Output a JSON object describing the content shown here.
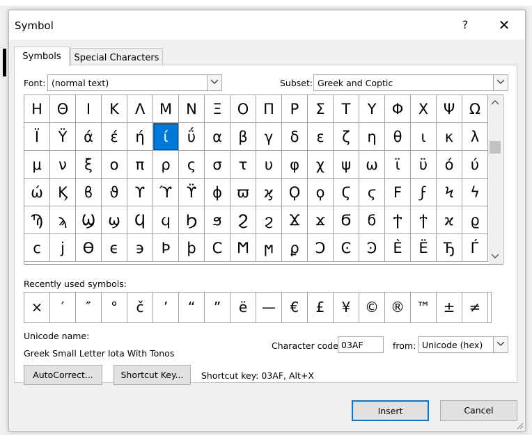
{
  "window": {
    "title": "Symbol",
    "help_label": "?",
    "close_label": "✕"
  },
  "tabs": [
    {
      "label": "Symbols",
      "active": true
    },
    {
      "label": "Special Characters",
      "active": false
    }
  ],
  "font": {
    "label": "Font:",
    "value": "(normal text)"
  },
  "subset": {
    "label": "Subset:",
    "value": "Greek and Coptic"
  },
  "symbol_grid": {
    "rows": [
      [
        "Η",
        "Θ",
        "Ι",
        "Κ",
        "Λ",
        "Μ",
        "Ν",
        "Ξ",
        "Ο",
        "Π",
        "Ρ",
        "Σ",
        "Τ",
        "Υ",
        "Φ",
        "Χ",
        "Ψ",
        "Ω"
      ],
      [
        "Ϊ",
        "Ϋ",
        "ά",
        "έ",
        "ή",
        "ί",
        "ΰ",
        "α",
        "β",
        "γ",
        "δ",
        "ε",
        "ζ",
        "η",
        "θ",
        "ι",
        "κ",
        "λ"
      ],
      [
        "μ",
        "ν",
        "ξ",
        "ο",
        "π",
        "ρ",
        "ς",
        "σ",
        "τ",
        "υ",
        "φ",
        "χ",
        "ψ",
        "ω",
        "ϊ",
        "ϋ",
        "ό",
        "ύ"
      ],
      [
        "ώ",
        "Ϗ",
        "ϐ",
        "ϑ",
        "ϒ",
        "ϓ",
        "ϔ",
        "ϕ",
        "ϖ",
        "ϗ",
        "Ϙ",
        "ϙ",
        "Ϛ",
        "ϛ",
        "Ϝ",
        "ϝ",
        "Ϟ",
        "ϟ"
      ],
      [
        "Ϡ",
        "ϡ",
        "Ϣ",
        "ϣ",
        "Ϥ",
        "ϥ",
        "Ϧ",
        "ϧ",
        "Ϩ",
        "ϩ",
        "Ϫ",
        "ϫ",
        "Ϭ",
        "ϭ",
        "Ϯ",
        "ϯ",
        "ϰ",
        "ϱ"
      ],
      [
        "ϲ",
        "ϳ",
        "ϴ",
        "ϵ",
        "϶",
        "Ϸ",
        "ϸ",
        "Ϲ",
        "Ϻ",
        "ϻ",
        "ϼ",
        "Ͻ",
        "Ͼ",
        "Ͽ",
        "Ѐ",
        "Ё",
        "Ђ",
        "Ѓ"
      ]
    ],
    "selected": {
      "row": 1,
      "col": 5
    }
  },
  "recent": {
    "label": "Recently used symbols:",
    "symbols": [
      "×",
      "′",
      "″",
      "°",
      "č",
      "’",
      "“",
      "”",
      "ë",
      "—",
      "€",
      "£",
      "¥",
      "©",
      "®",
      "™",
      "±",
      "≠"
    ]
  },
  "unicode_name": {
    "label": "Unicode name:",
    "value": "Greek Small Letter Iota With Tonos"
  },
  "character_code": {
    "label": "Character code:",
    "value": "03AF"
  },
  "from": {
    "label": "from:",
    "value": "Unicode (hex)"
  },
  "buttons": {
    "autocorrect": "AutoCorrect...",
    "shortcut_key": "Shortcut Key...",
    "insert": "Insert",
    "cancel": "Cancel"
  },
  "shortcut_text": "Shortcut key: 03AF, Alt+X",
  "colors": {
    "accent": "#0078d7"
  }
}
